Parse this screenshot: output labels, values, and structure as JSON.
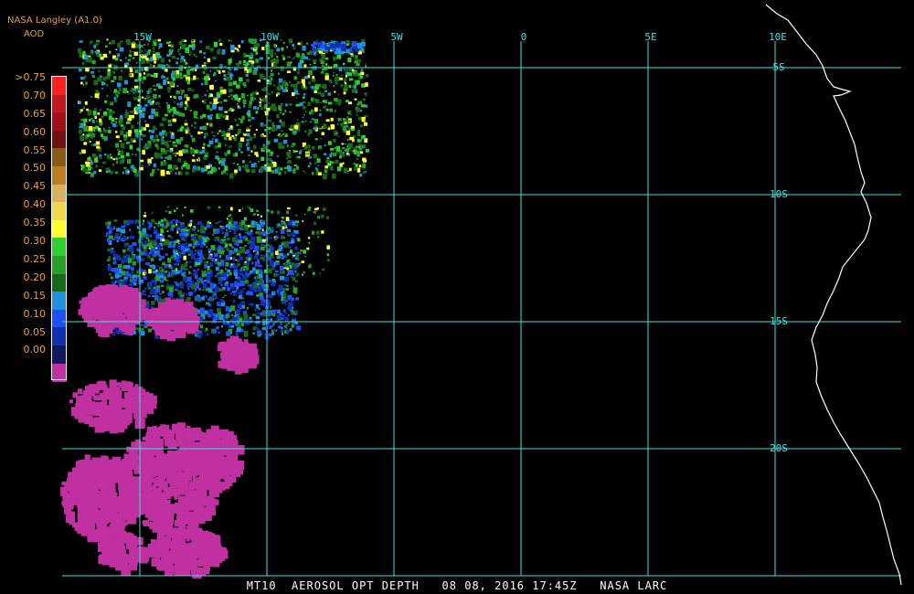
{
  "header": {
    "source": "NASA Langley (A1.0)",
    "product": "AOD"
  },
  "legend": {
    "ticks": [
      ">0.75",
      "0.70",
      "0.65",
      "0.60",
      "0.55",
      "0.50",
      "0.45",
      "0.40",
      "0.35",
      "0.30",
      "0.25",
      "0.20",
      "0.15",
      "0.10",
      "0.05",
      "0.00"
    ],
    "colors": [
      "#ff2020",
      "#c01820",
      "#a01018",
      "#701010",
      "#8a5a18",
      "#b8801e",
      "#d8b060",
      "#f0d850",
      "#ffff30",
      "#30d030",
      "#28a028",
      "#186818",
      "#2090e0",
      "#2050f0",
      "#1030b0",
      "#101860",
      "#c030a0"
    ]
  },
  "map": {
    "lon_labels": [
      "15W",
      "10W",
      "5W",
      "0",
      "5E",
      "10E"
    ],
    "lat_labels": [
      "5S",
      "10S",
      "15S",
      "20S"
    ],
    "grid_color": "#40e0e0",
    "coast_color": "#ffffff"
  },
  "caption": "MT10  AEROSOL OPT DEPTH   08 08, 2016 17:45Z   NASA LARC"
}
